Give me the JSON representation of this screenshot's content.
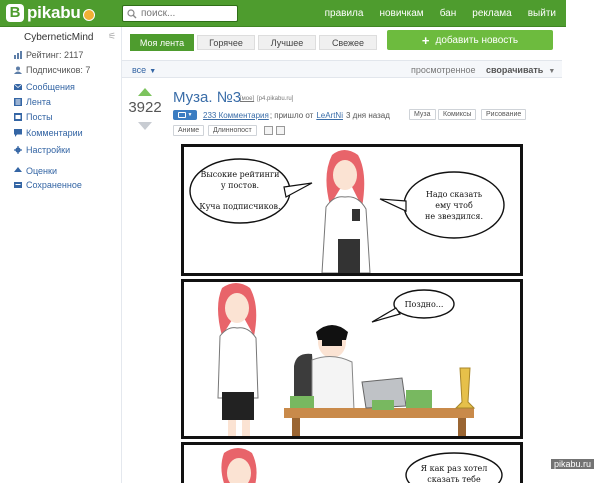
{
  "header": {
    "logo_letter": "B",
    "logo_text": "pikabu",
    "search_placeholder": "поиск...",
    "nav": [
      "правила",
      "новичкам",
      "бан",
      "реклама",
      "выйти"
    ]
  },
  "sidebar": {
    "username": "CyberneticMind",
    "rating": "Рейтинг: 2117",
    "subscribers": "Подписчиков: 7",
    "links": [
      "Сообщения",
      "Лента",
      "Посты",
      "Комментарии",
      "Настройки"
    ],
    "links2": [
      "Оценки",
      "Сохраненное"
    ]
  },
  "tabs": [
    "Моя лента",
    "Горячее",
    "Лучшее",
    "Свежее"
  ],
  "add_news": "добавить новость",
  "filter": {
    "all": "все",
    "seen": "просмотренное",
    "collapse": "сворачивать"
  },
  "post": {
    "votes": "3922",
    "title": "Муза. №3",
    "my_tag": "[мое]",
    "domain": "[p4.pikabu.ru]",
    "comments": "233 Комментария",
    "posted_by_prefix": "; пришло от",
    "author": "LeArtNi",
    "time": "3 дня назад",
    "tags": [
      "Муза",
      "Комиксы",
      "Рисование",
      "Аниме",
      "Длиннопост"
    ]
  },
  "comic": {
    "panel1_left": [
      "Высокие рейтинги",
      "у постов.",
      "Куча подписчиков."
    ],
    "panel1_right": [
      "Надо сказать",
      "ему чтоб",
      "не звездился."
    ],
    "panel2": "Поздно...",
    "panel3": [
      "Я как раз хотел",
      "сказать тебе"
    ]
  },
  "watermark": "pikabu.ru"
}
